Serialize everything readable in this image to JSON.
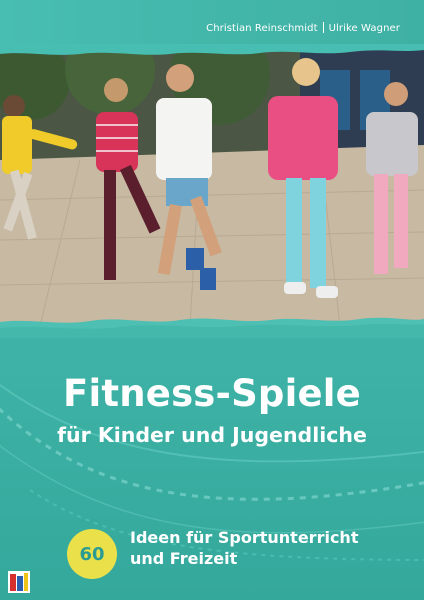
{
  "authors": {
    "first": "Christian Reinschmidt",
    "second": "Ulrike Wagner"
  },
  "title": {
    "main": "Fitness-Spiele",
    "sub": "für Kinder und Jugendliche"
  },
  "badge": {
    "number": "60"
  },
  "tagline": {
    "line1": "Ideen für Sportunterricht",
    "line2": "und Freizeit"
  },
  "colors": {
    "teal": "#3fb3a7",
    "badge_yellow": "#e9e04a",
    "text": "#ffffff"
  },
  "icons": {
    "publisher_logo": "publisher-logo-icon"
  }
}
